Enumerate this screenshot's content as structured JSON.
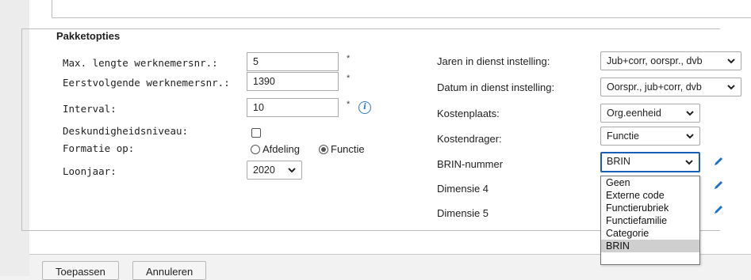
{
  "legend": "Pakketopties",
  "left_fields": {
    "max_length": {
      "label": "Max. lengte werknemersnr.:",
      "value": "5",
      "required": "*"
    },
    "next_number": {
      "label": "Eerstvolgende werknemersnr.:",
      "value": "1390",
      "required": "*"
    },
    "interval": {
      "label": "Interval:",
      "value": "10",
      "required": "*"
    },
    "skill_level": {
      "label": "Deskundigheidsniveau:",
      "checked": false
    },
    "formation": {
      "label": "Formatie op:",
      "options": [
        "Afdeling",
        "Functie"
      ],
      "selected": "Functie"
    },
    "loonjaar": {
      "label": "Loonjaar:",
      "value": "2020"
    }
  },
  "right_fields": {
    "jaren": {
      "label": "Jaren in dienst instelling:",
      "value": "Jub+corr, oorspr., dvb"
    },
    "datum": {
      "label": "Datum in dienst instelling:",
      "value": "Oorspr., jub+corr, dvb"
    },
    "kostenplaats": {
      "label": "Kostenplaats:",
      "value": "Org.eenheid"
    },
    "kostendrager": {
      "label": "Kostendrager:",
      "value": "Functie"
    },
    "brin": {
      "label": "BRIN-nummer",
      "value": "BRIN"
    },
    "dim4": {
      "label": "Dimensie 4"
    },
    "dim5": {
      "label": "Dimensie 5"
    }
  },
  "dropdown_options": [
    "Geen",
    "Externe code",
    "Functierubriek",
    "Functiefamilie",
    "Categorie",
    "BRIN"
  ],
  "dropdown_selected": "BRIN",
  "buttons": {
    "apply": "Toepassen",
    "cancel": "Annuleren"
  },
  "icons": {
    "info": "info-icon",
    "edit": "pencil-icon",
    "chevron": "chevron-down-icon"
  },
  "colors": {
    "accent": "#1a5fb4",
    "info": "#2a7ad1"
  }
}
